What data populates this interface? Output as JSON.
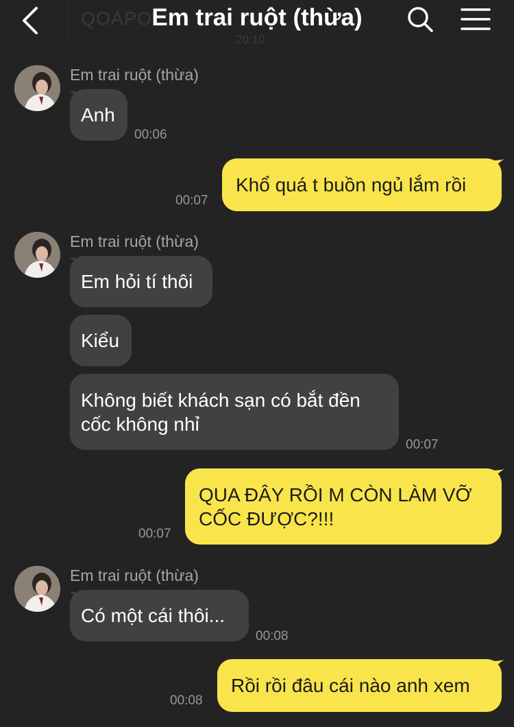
{
  "header": {
    "title": "Em trai ruột (thừa)",
    "ghost_text": "QOAPO",
    "ghost_time": "20:10"
  },
  "icons": {
    "back": "chevron-left-icon",
    "search": "search-icon",
    "menu": "hamburger-menu-icon"
  },
  "colors": {
    "background": "#232324",
    "incoming_bubble": "#414143",
    "outgoing_bubble": "#f9e54b",
    "timestamp": "#97979b",
    "sender_name": "#a5a5a8"
  },
  "messages": [
    {
      "sender": "Em trai ruột (thừa)",
      "text": "Anh",
      "time": "00:06"
    },
    {
      "sender": "me",
      "text": "Khổ quá t buồn ngủ lắm rồi",
      "time": "00:07"
    },
    {
      "sender": "Em trai ruột (thừa)",
      "text": "Em hỏi tí thôi"
    },
    {
      "text": "Kiểu"
    },
    {
      "line1": "Không biết khách sạn có bắt đền",
      "line2": "cốc không nhỉ",
      "time": "00:07"
    },
    {
      "sender": "me",
      "line1": "QUA ĐÂY RỒI M CÒN LÀM VỠ",
      "line2": "CỐC ĐƯỢC?!!!",
      "time": "00:07"
    },
    {
      "sender": "Em trai ruột (thừa)",
      "text": "Có một cái thôi...",
      "time": "00:08"
    },
    {
      "sender": "me",
      "text": "Rồi rồi đâu cái nào anh xem",
      "time": "00:08"
    }
  ]
}
